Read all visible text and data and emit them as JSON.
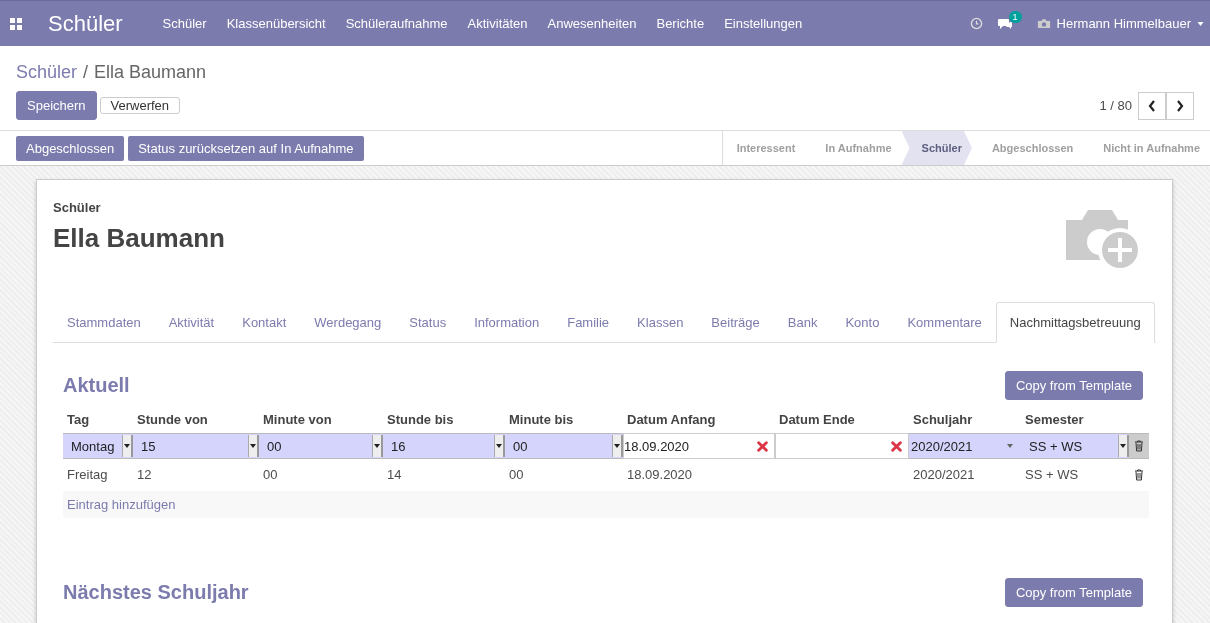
{
  "navbar": {
    "app_title": "Schüler",
    "menu": [
      "Schüler",
      "Klassenübersicht",
      "Schüleraufnahme",
      "Aktivitäten",
      "Anwesenheiten",
      "Berichte",
      "Einstellungen"
    ],
    "message_count": "1",
    "user": "Hermann Himmelbauer"
  },
  "breadcrumb": {
    "parent": "Schüler",
    "separator": "/",
    "current": "Ella Baumann"
  },
  "buttons": {
    "save": "Speichern",
    "discard": "Verwerfen"
  },
  "pager": "1 / 80",
  "status_buttons": [
    "Abgeschlossen",
    "Status zurücksetzen auf In Aufnahme"
  ],
  "stages": [
    {
      "label": "Interessent",
      "selected": false
    },
    {
      "label": "In Aufnahme",
      "selected": false
    },
    {
      "label": "Schüler",
      "selected": true
    },
    {
      "label": "Abgeschlossen",
      "selected": false
    },
    {
      "label": "Nicht in Aufnahme",
      "selected": false
    }
  ],
  "record": {
    "type_label": "Schüler",
    "name": "Ella Baumann"
  },
  "tabs": [
    {
      "label": "Stammdaten",
      "selected": false
    },
    {
      "label": "Aktivität",
      "selected": false
    },
    {
      "label": "Kontakt",
      "selected": false
    },
    {
      "label": "Werdegang",
      "selected": false
    },
    {
      "label": "Status",
      "selected": false
    },
    {
      "label": "Information",
      "selected": false
    },
    {
      "label": "Familie",
      "selected": false
    },
    {
      "label": "Klassen",
      "selected": false
    },
    {
      "label": "Beiträge",
      "selected": false
    },
    {
      "label": "Bank",
      "selected": false
    },
    {
      "label": "Konto",
      "selected": false
    },
    {
      "label": "Kommentare",
      "selected": false
    },
    {
      "label": "Nachmittagsbetreuung",
      "selected": true
    }
  ],
  "sections": [
    {
      "title": "Aktuell",
      "button": "Copy from Template",
      "columns": [
        {
          "label": "Tag",
          "kind": "select"
        },
        {
          "label": "Stunde von",
          "kind": "select"
        },
        {
          "label": "Minute von",
          "kind": "select"
        },
        {
          "label": "Stunde bis",
          "kind": "select"
        },
        {
          "label": "Minute bis",
          "kind": "select"
        },
        {
          "label": "Datum Anfang",
          "kind": "date"
        },
        {
          "label": "Datum Ende",
          "kind": "date"
        },
        {
          "label": "Schuljahr",
          "kind": "combo"
        },
        {
          "label": "Semester",
          "kind": "select"
        }
      ],
      "rows": [
        {
          "editing": true,
          "cells": [
            "Montag",
            "15",
            "00",
            "16",
            "00",
            "18.09.2020",
            null,
            "2020/2021",
            "SS + WS"
          ]
        },
        {
          "editing": false,
          "cells": [
            "Freitag",
            "12",
            "00",
            "14",
            "00",
            "18.09.2020",
            null,
            "2020/2021",
            "SS + WS"
          ]
        }
      ],
      "add_link": "Eintrag hinzufügen"
    },
    {
      "title": "Nächstes Schuljahr",
      "button": "Copy from Template"
    }
  ]
}
